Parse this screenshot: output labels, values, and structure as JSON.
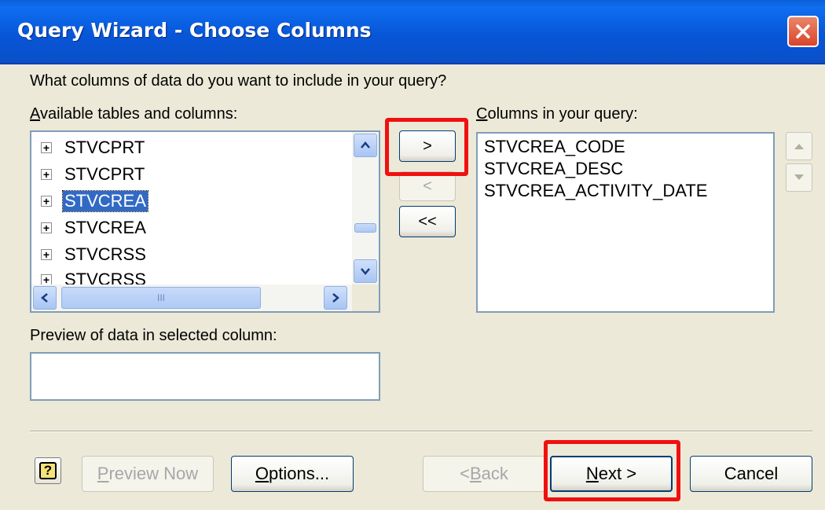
{
  "window": {
    "title": "Query Wizard - Choose Columns"
  },
  "prompt": "What columns of data do you want to include in your query?",
  "available": {
    "label_first": "A",
    "label_rest": "vailable tables and columns:",
    "items": [
      {
        "label": "STVCPRT",
        "selected": false
      },
      {
        "label": "STVCPRT",
        "selected": false
      },
      {
        "label": "STVCREA",
        "selected": true
      },
      {
        "label": "STVCREA",
        "selected": false
      },
      {
        "label": "STVCRSS",
        "selected": false
      },
      {
        "label": "STVCRSS",
        "selected": false
      }
    ],
    "tree_expand_glyph": "+",
    "hscroll_grip": "III"
  },
  "mover": {
    "add_label": ">",
    "remove_label": "<",
    "remove_all_label": "<<"
  },
  "query": {
    "label_first": "C",
    "label_rest": "olumns in your query:",
    "items": [
      "STVCREA_CODE",
      "STVCREA_DESC",
      "STVCREA_ACTIVITY_DATE"
    ]
  },
  "preview": {
    "label": "Preview of data in selected column:",
    "value": ""
  },
  "footer": {
    "help_glyph": "?",
    "preview_now": {
      "first": "P",
      "rest": "review Now"
    },
    "options": {
      "first": "O",
      "rest": "ptions..."
    },
    "back": {
      "pre": "< ",
      "first": "B",
      "rest": "ack"
    },
    "next": {
      "first": "N",
      "rest": "ext >"
    },
    "cancel": "Cancel"
  },
  "colors": {
    "titlebar": "#0a5fd8",
    "selection": "#316ac5",
    "highlight": "#f01010"
  }
}
